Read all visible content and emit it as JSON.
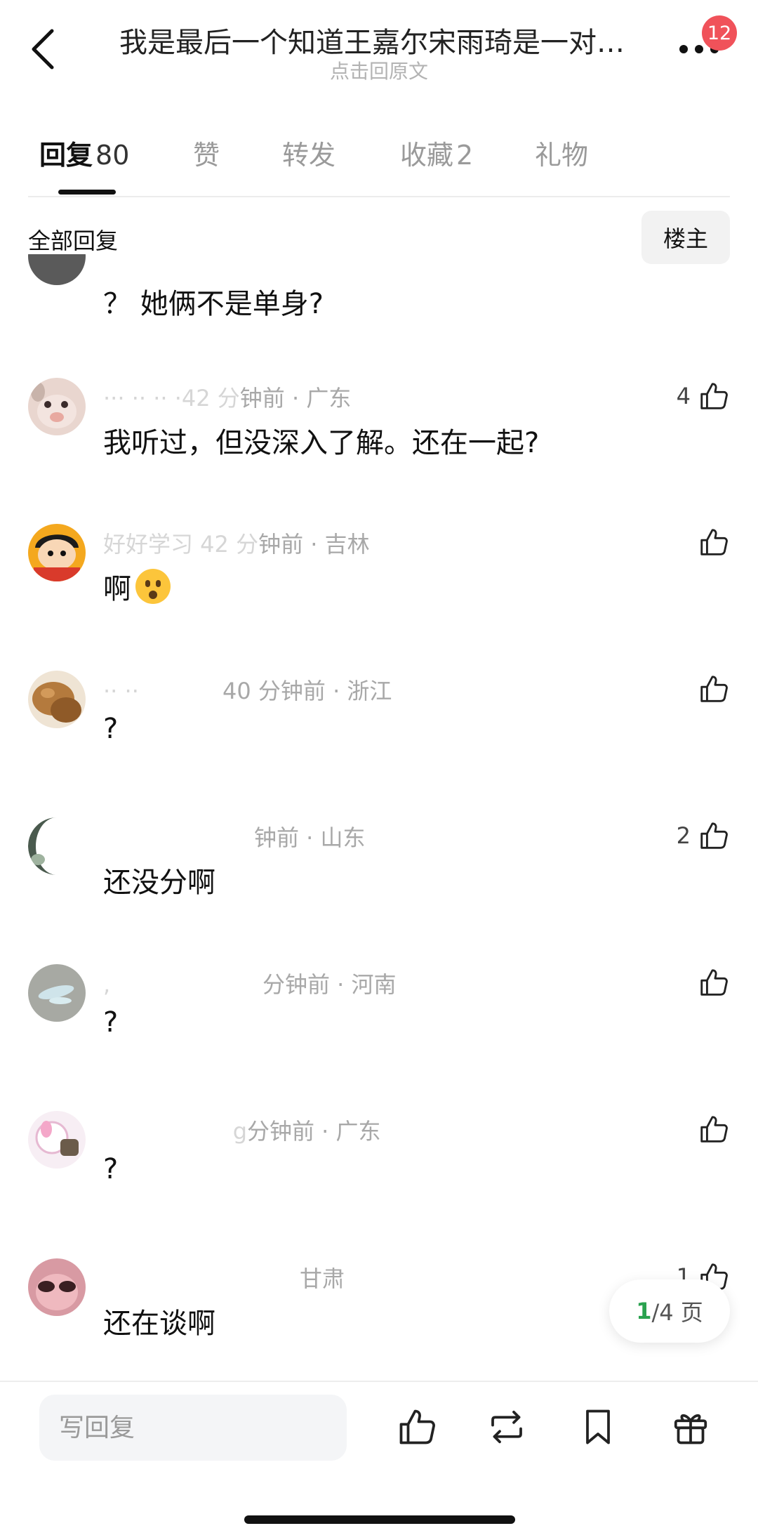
{
  "header": {
    "title": "我是最后一个知道王嘉尔宋雨琦是一对…",
    "subtitle": "点击回原文",
    "notification_count": "12",
    "back_icon": "chevron-left-icon",
    "more_icon": "more-dots-icon"
  },
  "tabs": [
    {
      "label": "回复",
      "count": "80",
      "active": true
    },
    {
      "label": "赞",
      "count": ""
    },
    {
      "label": "转发",
      "count": ""
    },
    {
      "label": "收藏",
      "count": "2"
    },
    {
      "label": "礼物",
      "count": ""
    }
  ],
  "section": {
    "title": "全部回复",
    "owner_filter": "楼主"
  },
  "partial_comment": {
    "text": "？ 她俩不是单身?"
  },
  "comments": [
    {
      "meta_ghost": "··· ·· ·· ·42 分",
      "meta": "钟前 · 广东",
      "text": "我听过，但没深入了解。还在一起?",
      "likes": "4"
    },
    {
      "meta_ghost": "好好学习 42 分",
      "meta": "钟前 · 吉林",
      "text": "啊",
      "likes": ""
    },
    {
      "meta_ghost": "·· ··",
      "meta": "40 分钟前 · 浙江",
      "text": "?",
      "likes": ""
    },
    {
      "meta_ghost": "",
      "meta": "钟前 · 山东",
      "text": "还没分啊",
      "likes": "2"
    },
    {
      "meta_ghost": ",",
      "meta": "分钟前 · 河南",
      "text": "?",
      "likes": ""
    },
    {
      "meta_ghost": "g",
      "meta": "分钟前 · 广东",
      "text": "?",
      "likes": ""
    },
    {
      "meta_ghost": "",
      "meta": "甘肃",
      "text": "还在谈啊",
      "likes": "1"
    }
  ],
  "pagination": {
    "current": "1",
    "rest": "/4 页"
  },
  "bottom_bar": {
    "reply_placeholder": "写回复",
    "icons": [
      "thumbs-up-icon",
      "repost-icon",
      "bookmark-icon",
      "gift-icon"
    ]
  },
  "colors": {
    "accent_green": "#2aa24f",
    "badge_red": "#f0525a"
  }
}
